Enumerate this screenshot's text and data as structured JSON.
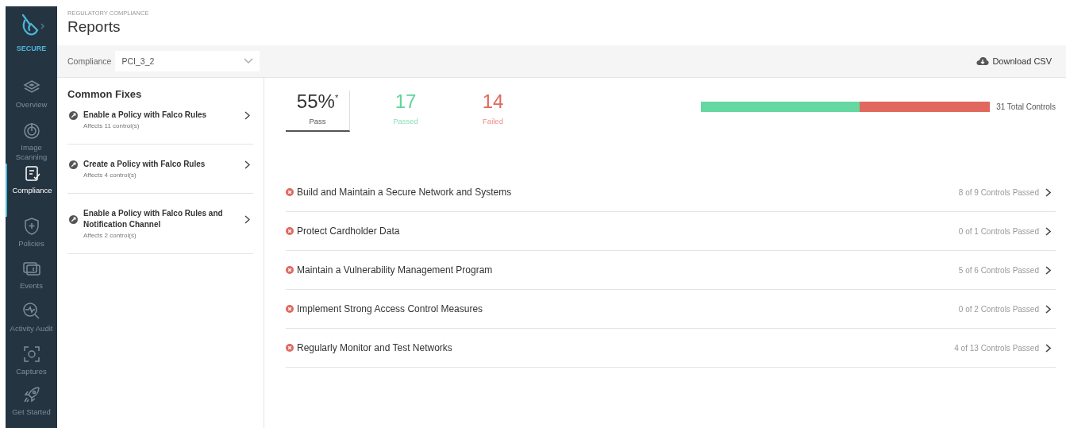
{
  "sidebar": {
    "product": "SECURE",
    "items": [
      {
        "label": "Overview",
        "selected": false
      },
      {
        "label": "Image Scanning",
        "selected": false
      },
      {
        "label": "Compliance",
        "selected": true
      },
      {
        "label": "Policies",
        "selected": false
      },
      {
        "label": "Events",
        "selected": false
      },
      {
        "label": "Activity Audit",
        "selected": false
      },
      {
        "label": "Captures",
        "selected": false
      },
      {
        "label": "Get Started",
        "selected": false
      }
    ]
  },
  "header": {
    "breadcrumb": "REGULATORY COMPLIANCE",
    "title": "Reports"
  },
  "toolbar": {
    "filter_label": "Compliance",
    "filter_value": "PCI_3_2",
    "download": "Download CSV"
  },
  "common_fixes": {
    "title": "Common Fixes",
    "items": [
      {
        "title": "Enable a Policy with Falco Rules",
        "affects": "Affects 11 control(s)"
      },
      {
        "title": "Create a Policy with Falco Rules",
        "affects": "Affects 4 control(s)"
      },
      {
        "title": "Enable a Policy with Falco Rules and Notification Channel",
        "affects": "Affects 2 control(s)"
      }
    ]
  },
  "summary": {
    "stats": [
      {
        "value": "55%$^{*}$",
        "label": "Pass",
        "selected": true,
        "color": "#333333"
      },
      {
        "value": "17",
        "label": "Passed",
        "selected": false,
        "color": "#5fd49a"
      },
      {
        "value": "14",
        "label": "Failed",
        "selected": false,
        "color": "#e0685e"
      }
    ],
    "bar": {
      "level": 0.55
    },
    "total": "31 Total Controls"
  },
  "requirements": [
    {
      "title": "Build and Maintain a Secure Network and Systems",
      "result": "8 of 9 Controls Passed"
    },
    {
      "title": "Protect Cardholder Data",
      "result": "0 of 1 Controls Passed"
    },
    {
      "title": "Maintain a Vulnerability Management Program",
      "result": "5 of 6 Controls Passed"
    },
    {
      "title": "Implement Strong Access Control Measures",
      "result": "0 of 2 Controls Passed"
    },
    {
      "title": "Regularly Monitor and Test Networks",
      "result": "4 of 13 Controls Passed"
    }
  ]
}
